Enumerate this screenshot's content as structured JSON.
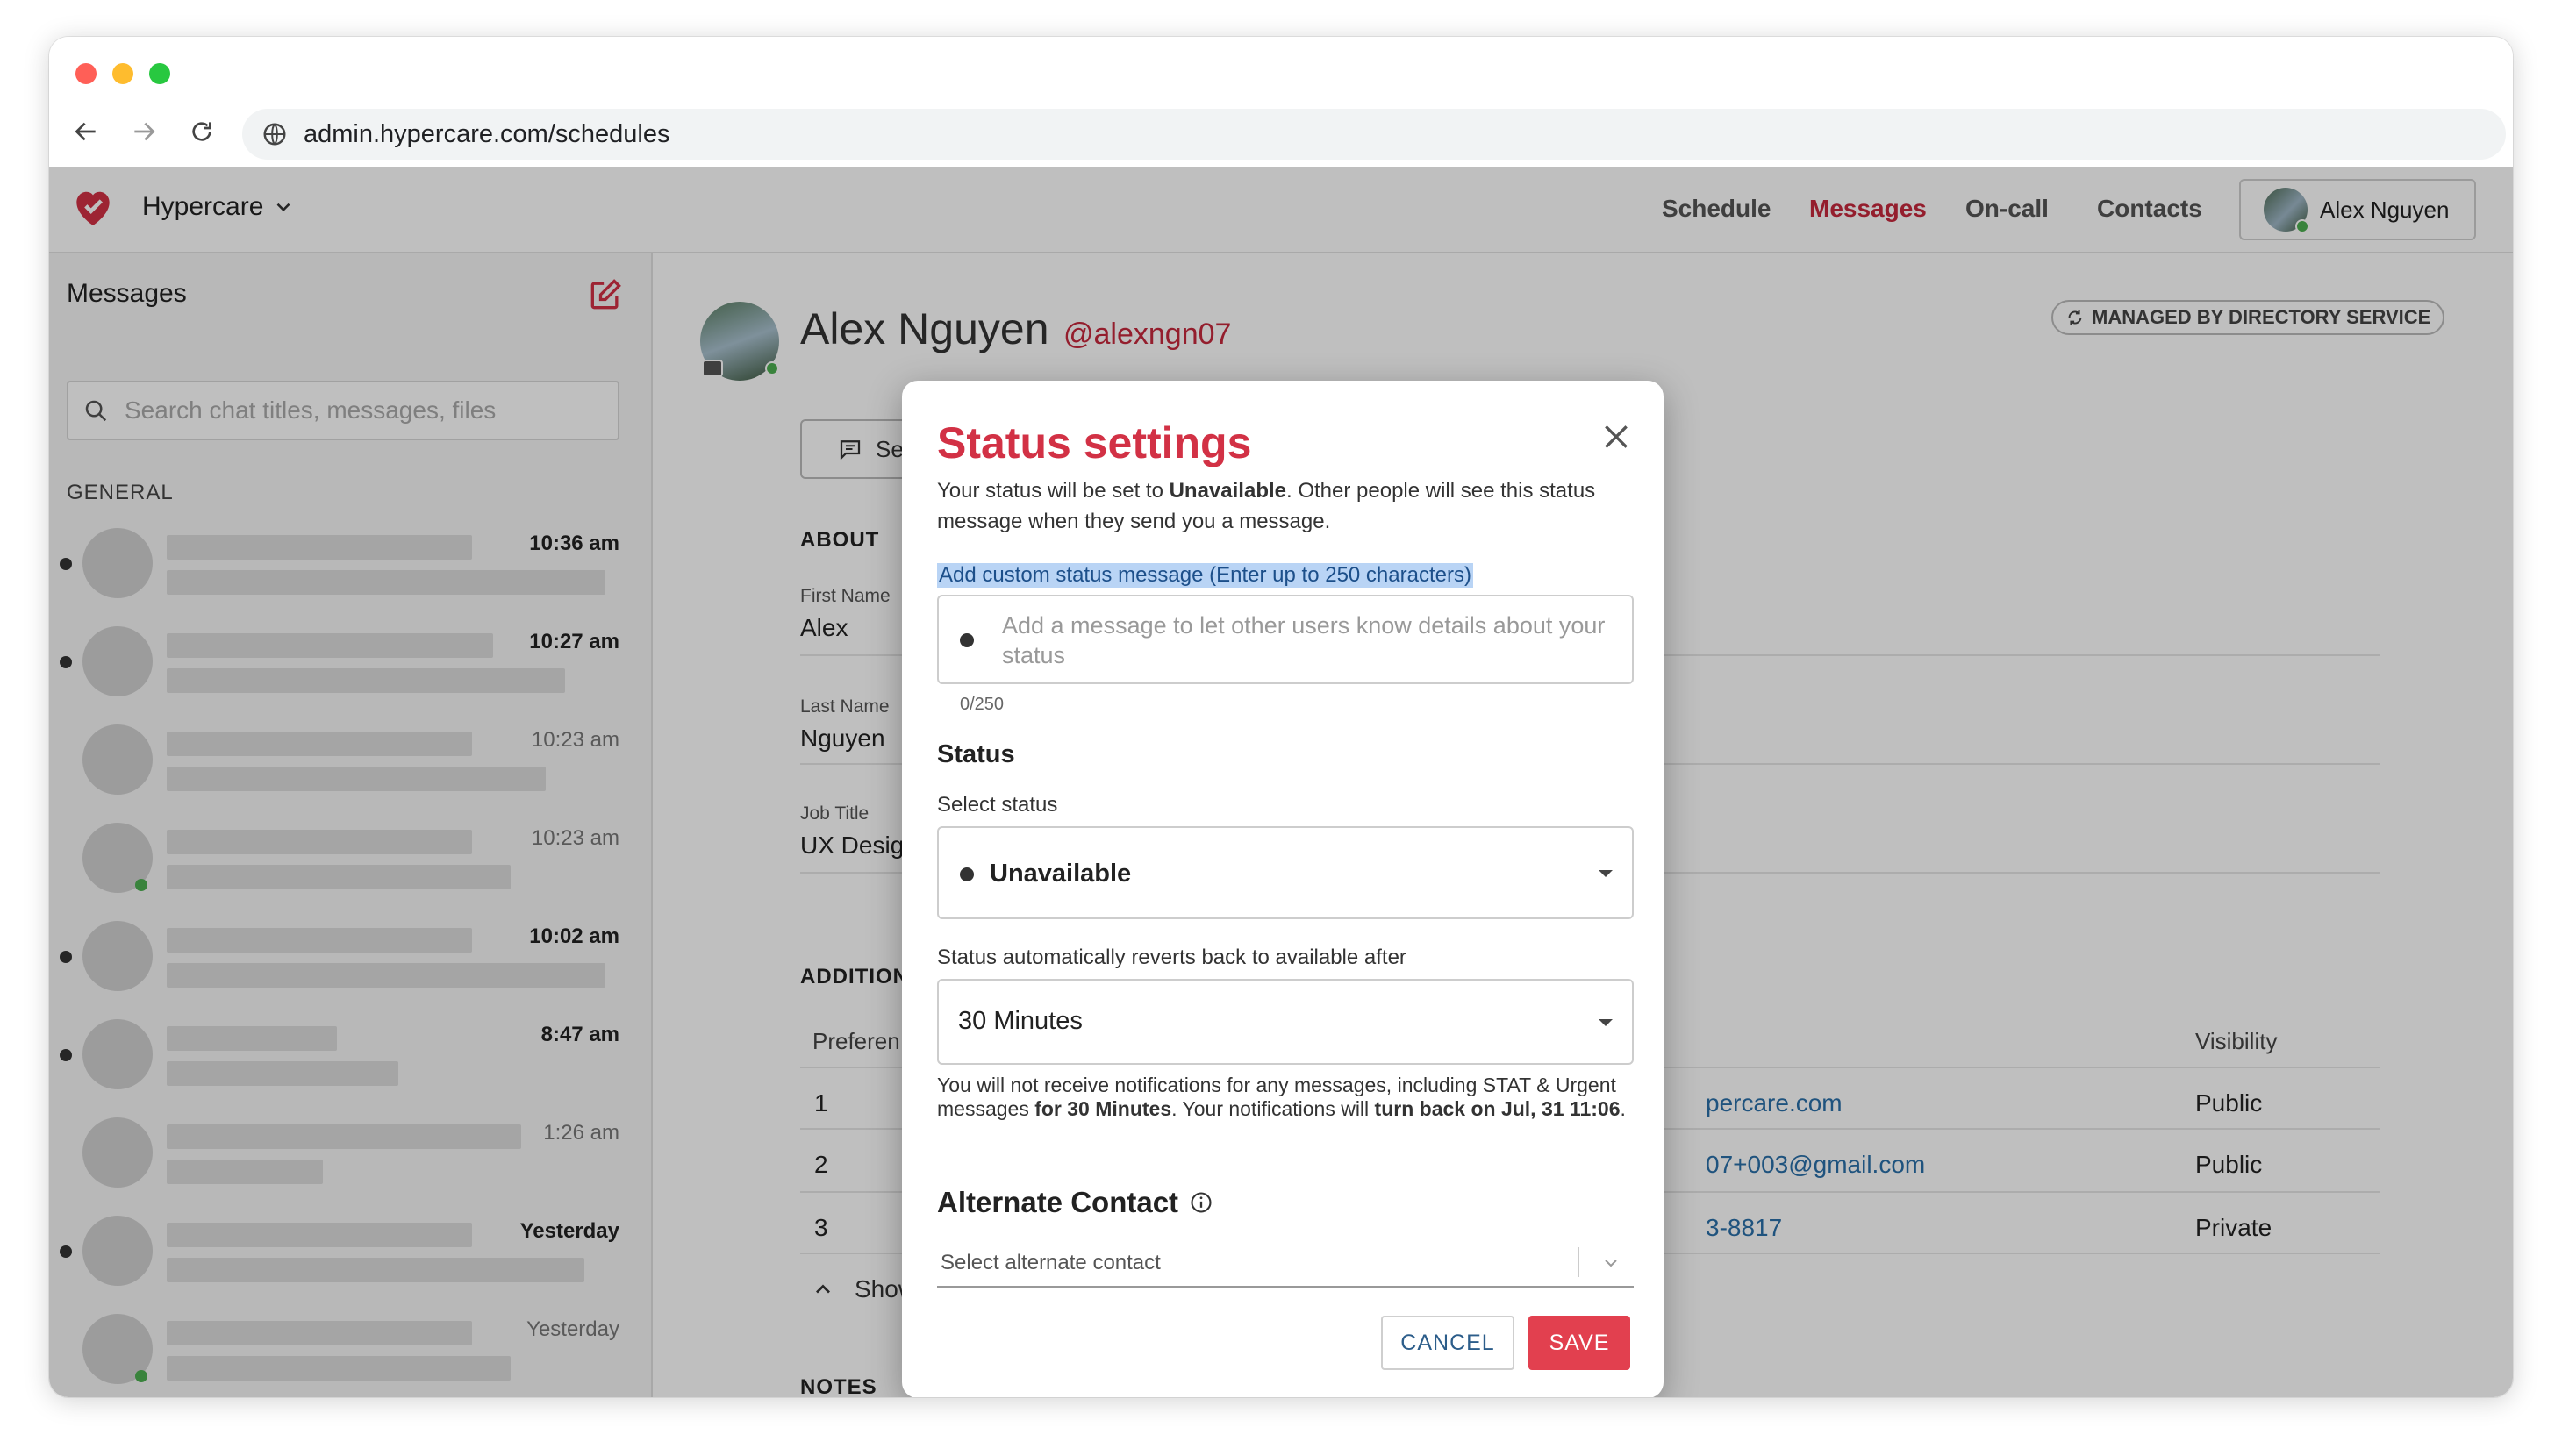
{
  "browser": {
    "url": "admin.hypercare.com/schedules"
  },
  "topnav": {
    "brand": "Hypercare",
    "menu": [
      "Schedule",
      "Messages",
      "On-call",
      "Contacts"
    ],
    "active_menu": "Messages",
    "user": "Alex Nguyen"
  },
  "sidebar": {
    "title": "Messages",
    "search_placeholder": "Search chat titles, messages, files",
    "section": "GENERAL",
    "chats": [
      {
        "time": "10:36 am",
        "unread": true,
        "online": false
      },
      {
        "time": "10:27 am",
        "unread": true,
        "online": false
      },
      {
        "time": "10:23 am",
        "unread": false,
        "online": false
      },
      {
        "time": "10:23 am",
        "unread": false,
        "online": true
      },
      {
        "time": "10:02 am",
        "unread": true,
        "online": false
      },
      {
        "time": "8:47 am",
        "unread": true,
        "online": false
      },
      {
        "time": "1:26 am",
        "unread": false,
        "online": false
      },
      {
        "time": "Yesterday",
        "unread": true,
        "online": false
      },
      {
        "time": "Yesterday",
        "unread": false,
        "online": true
      }
    ]
  },
  "profile": {
    "name": "Alex Nguyen",
    "handle": "@alexngn07",
    "managed_badge": "MANAGED BY DIRECTORY SERVICE",
    "send_label": "Se",
    "about_title": "ABOUT",
    "first_name_label": "First Name",
    "first_name": "Alex",
    "last_name_label": "Last Name",
    "last_name": "Nguyen",
    "job_title_label": "Job Title",
    "job_title": "UX Desig",
    "additional_title": "ADDITION",
    "table": {
      "col_pref": "Preferen",
      "col_visibility": "Visibility",
      "rows": [
        {
          "pref": "1",
          "value": "percare.com",
          "visibility": "Public"
        },
        {
          "pref": "2",
          "value": "07+003@gmail.com",
          "visibility": "Public"
        },
        {
          "pref": "3",
          "value": "3-8817",
          "visibility": "Private"
        }
      ]
    },
    "show_label": "Show",
    "notes_title": "NOTES"
  },
  "modal": {
    "title": "Status settings",
    "desc_prefix": "Your status will be set to ",
    "desc_status": "Unavailable",
    "desc_suffix": ". Other people will see this status message when they send you a message.",
    "custom_label": "Add custom status message (Enter up to 250 characters)",
    "message_placeholder": "Add a message to let other users know details about your status",
    "counter": "0/250",
    "status_heading": "Status",
    "select_status_label": "Select status",
    "selected_status": "Unavailable",
    "revert_label": "Status automatically reverts back to available after",
    "revert_value": "30 Minutes",
    "notice_1": "You will not receive notifications for any messages, including STAT & Urgent messages ",
    "notice_duration": "for 30 Minutes",
    "notice_2": ". Your notifications will ",
    "notice_turnback": "turn back on Jul, 31 11:06",
    "notice_3": ".",
    "alt_heading": "Alternate Contact",
    "alt_placeholder": "Select alternate contact",
    "cancel": "CANCEL",
    "save": "SAVE"
  },
  "colors": {
    "brand": "#d23145",
    "save": "#e2404f",
    "link": "#2a6fa8",
    "online": "#4caf50"
  }
}
